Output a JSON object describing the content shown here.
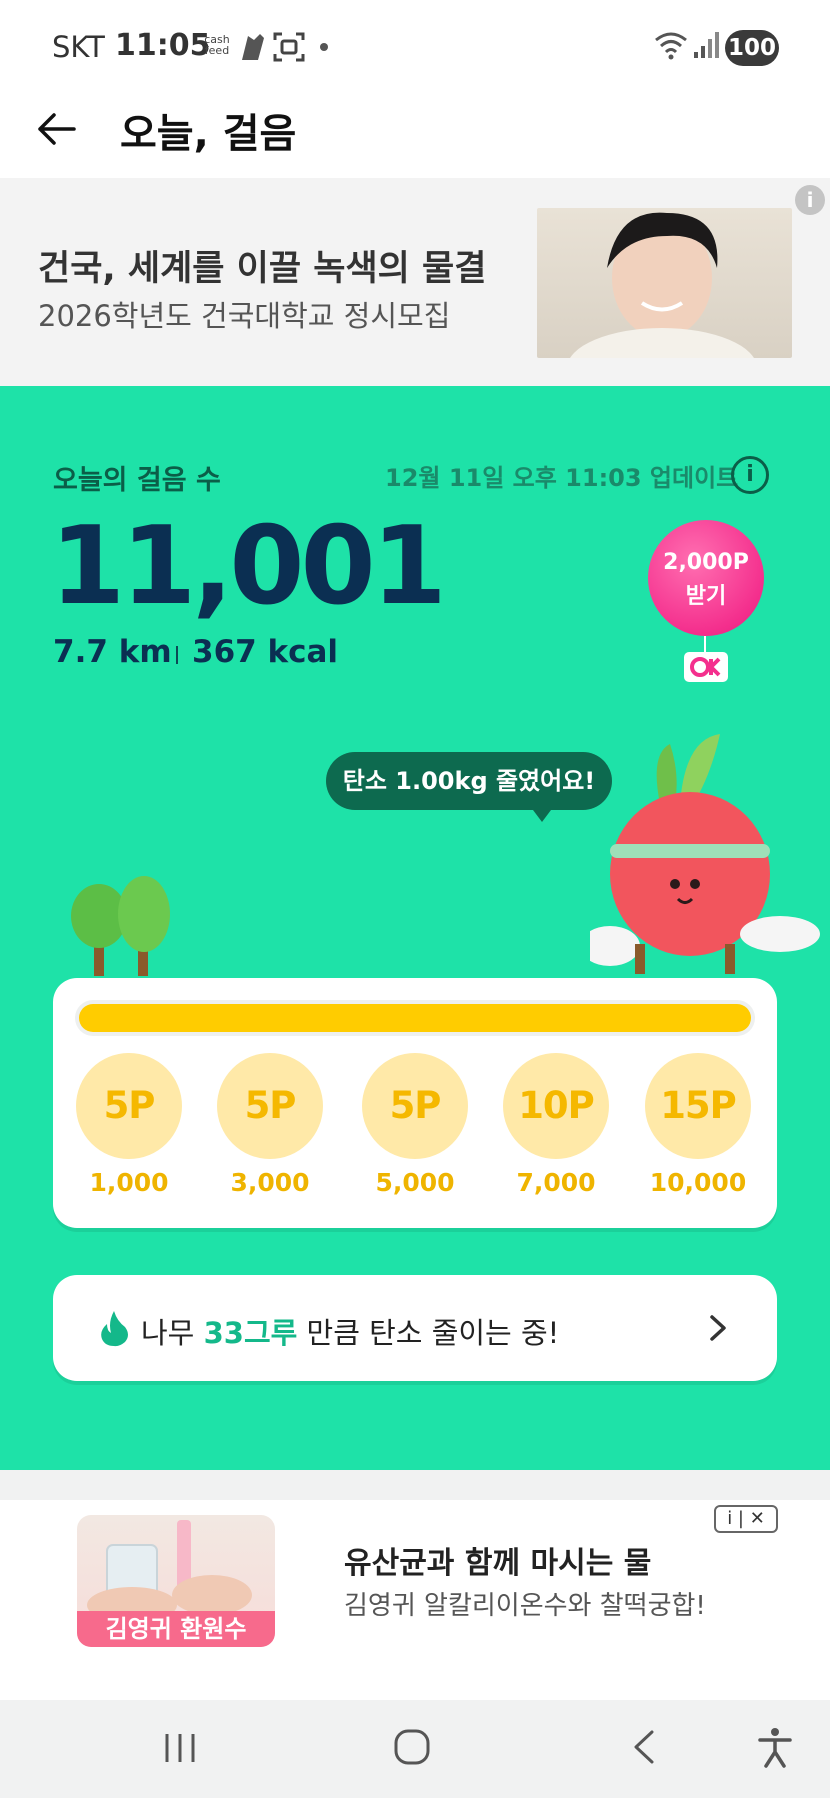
{
  "status_bar": {
    "carrier": "SKT",
    "time": "11:05",
    "app_badge": "cash feed",
    "battery": "100"
  },
  "header": {
    "title": "오늘, 걸음"
  },
  "top_ad": {
    "title": "건국, 세계를 이끌 녹색의 물결",
    "subtitle": "2026학년도 건국대학교 정시모집",
    "info": "i"
  },
  "steps": {
    "label": "오늘의 걸음 수",
    "update": "12월 11일 오후 11:03 업데이트",
    "count": "11,001",
    "distance": "7.7 km",
    "calories": "367 kcal",
    "info": "i"
  },
  "reward_balloon": {
    "amount": "2,000P",
    "action": "받기"
  },
  "carbon_bubble": "탄소 1.00kg 줄였어요!",
  "progress": {
    "fraction": 1.0,
    "milestones": [
      {
        "points": "5P",
        "steps": "1,000"
      },
      {
        "points": "5P",
        "steps": "3,000"
      },
      {
        "points": "5P",
        "steps": "5,000"
      },
      {
        "points": "10P",
        "steps": "7,000"
      },
      {
        "points": "15P",
        "steps": "10,000"
      }
    ]
  },
  "tree_banner": {
    "prefix": "나무",
    "count": "33그루",
    "suffix": "만큼 탄소 줄이는 중!"
  },
  "bottom_ad": {
    "image_label": "김영귀 환원수",
    "title": "유산균과 함께 마시는 물",
    "subtitle": "김영귀 알칼리이온수와 찰떡궁합!",
    "close_label": "i | ✕"
  },
  "colors": {
    "green_bg": "#1ee2a8",
    "progress": "#ffcc00",
    "milestone_bg": "#ffe9a8",
    "balloon": "#f42f8d"
  }
}
